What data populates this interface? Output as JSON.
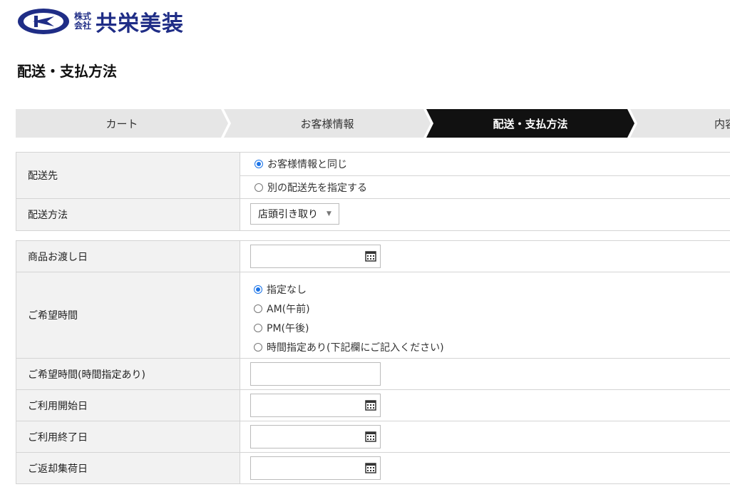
{
  "logo": {
    "small_top": "株式",
    "small_bottom": "会社",
    "name": "共栄美装"
  },
  "page_title": "配送・支払方法",
  "steps": [
    {
      "label": "カート",
      "active": false
    },
    {
      "label": "お客様情報",
      "active": false
    },
    {
      "label": "配送・支払方法",
      "active": true
    },
    {
      "label": "内容",
      "active": false
    }
  ],
  "colors": {
    "step_inactive": "#e6e6e6",
    "step_active": "#111111",
    "label_bg": "#f2f2f2",
    "brand": "#1f2d86",
    "radio_accent": "#1a73e8"
  },
  "delivery": {
    "destination_label": "配送先",
    "destination_options": [
      {
        "label": "お客様情報と同じ",
        "checked": true
      },
      {
        "label": "別の配送先を指定する",
        "checked": false
      }
    ],
    "method_label": "配送方法",
    "method_value": "店頭引き取り"
  },
  "schedule": {
    "handover_label": "商品お渡し日",
    "handover_value": "",
    "time_label": "ご希望時間",
    "time_options": [
      {
        "label": "指定なし",
        "checked": true
      },
      {
        "label": "AM(午前)",
        "checked": false
      },
      {
        "label": "PM(午後)",
        "checked": false
      },
      {
        "label": "時間指定あり(下記欄にご記入ください)",
        "checked": false
      }
    ],
    "time_specified_label": "ご希望時間(時間指定あり)",
    "time_specified_value": "",
    "start_label": "ご利用開始日",
    "start_value": "",
    "end_label": "ご利用終了日",
    "end_value": "",
    "return_label": "ご返却集荷日",
    "return_value": ""
  },
  "icons": {
    "calendar": "calendar-icon",
    "select_arrow": "chevron-down-icon"
  }
}
